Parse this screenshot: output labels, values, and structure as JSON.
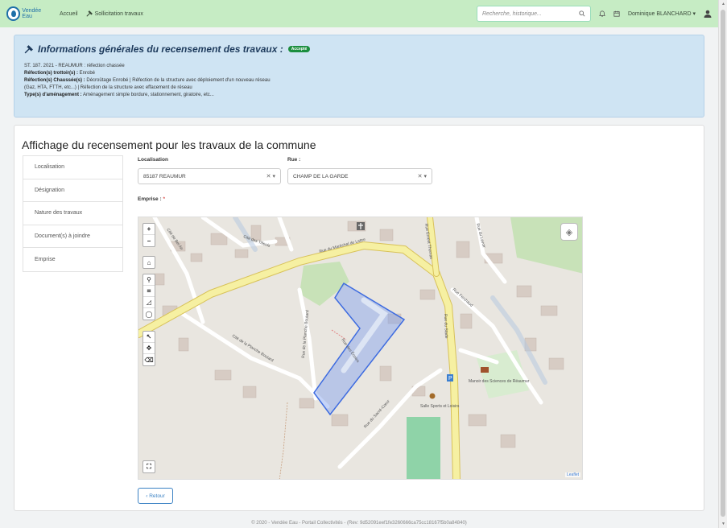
{
  "navbar": {
    "logo_text": "Vendée Eau",
    "links": [
      {
        "label": "Accueil"
      },
      {
        "label": "Sollicitation travaux"
      }
    ],
    "search_placeholder": "Recherche, historique...",
    "user_name": "Dominique BLANCHARD"
  },
  "info": {
    "title": "Informations générales du recensement des travaux :",
    "status_badge": "Accepté",
    "line1": "ST. 187. 2021 - REAUMUR : réfection chassée",
    "line2_label": "Réfection(s) trottoir(s) :",
    "line2_value": "Enrobé",
    "line3_label": "Réfection(s) Chaussée(s) :",
    "line3_value": "Décroûtage Enrobé | Réfection de la structure avec déploiement d'un nouveau réseau",
    "line4": "(Gaz, HTA, FTTH, etc...) | Réfection de la structure avec effacement de réseau",
    "line5_label": "Type(s) d'aménagement :",
    "line5_value": "Aménagement simple bordure, stationnement, giratoire, etc..."
  },
  "main": {
    "heading": "Affichage du recensement pour les travaux de la commune",
    "tabs": [
      {
        "label": "Localisation"
      },
      {
        "label": "Désignation"
      },
      {
        "label": "Nature des travaux"
      },
      {
        "label": "Document(s) à joindre"
      },
      {
        "label": "Emprise"
      }
    ],
    "localisation_label": "Localisation",
    "localisation_value": "85187 REAUMUR",
    "rue_label": "Rue :",
    "rue_value": "CHAMP DE LA GARDE",
    "emprise_label": "Emprise :",
    "required_mark": "*",
    "back_label": "‹ Retour"
  },
  "map": {
    "attribution": "Leaflet",
    "streets": [
      "Rue du Maréchal de Lattre",
      "Rue du Stade",
      "Rue des Écoles",
      "Cité de la Planche Boutard",
      "Rue du Sacré-Cœur",
      "Rue Ferchaud",
      "Rue de la Planche Boutard",
      "Cité des Tilleuls",
      "Cité de Bel Air",
      "Rue du Lavoir",
      "Rue Ernest Thomas"
    ],
    "pois": [
      "Salle Sports et Loisirs",
      "Manoir des Sciences de Réaumur"
    ],
    "controls": [
      "+",
      "−",
      "home",
      "marker",
      "rectangle",
      "polygon",
      "circle",
      "edit",
      "move",
      "erase",
      "fullscreen"
    ]
  },
  "footer": "© 2020 - Vendée Eau - Portail Collectivités - (Rev: 9d52091eef1fe3260666ca75cc18167f5b0a84840)"
}
